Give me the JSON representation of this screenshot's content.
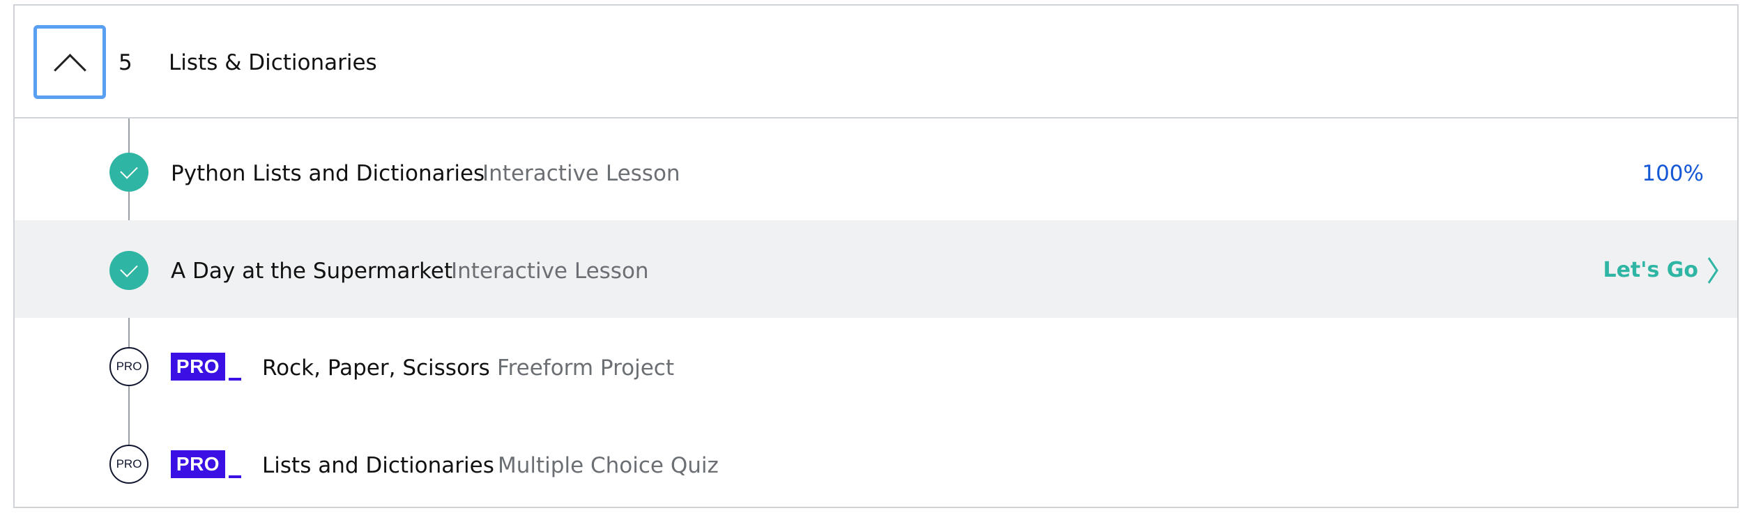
{
  "module": {
    "number": "5",
    "title": "Lists & Dictionaries",
    "collapse_icon": "chevron-up-icon"
  },
  "lessons": [
    {
      "title": "Python Lists and Dictionaries",
      "type": "Interactive Lesson",
      "status": "complete",
      "status_icon": "check-icon",
      "progress": "100%"
    },
    {
      "title": "A Day at the Supermarket",
      "type": "Interactive Lesson",
      "status": "complete",
      "status_icon": "check-icon",
      "action_label": "Let's Go",
      "action_icon": "chevron-right-icon"
    },
    {
      "title": "Rock, Paper, Scissors",
      "type": "Freeform Project",
      "status": "pro",
      "status_label": "PRO",
      "badge": "PRO"
    },
    {
      "title": "Lists and Dictionaries",
      "type": "Multiple Choice Quiz",
      "status": "pro",
      "status_label": "PRO",
      "badge": "PRO"
    }
  ],
  "colors": {
    "complete": "#2fb5a3",
    "pro_badge": "#3a10e5",
    "progress_text": "#1557d5",
    "focus_ring": "#5aa0f2",
    "highlight_row": "#f0f1f2"
  }
}
